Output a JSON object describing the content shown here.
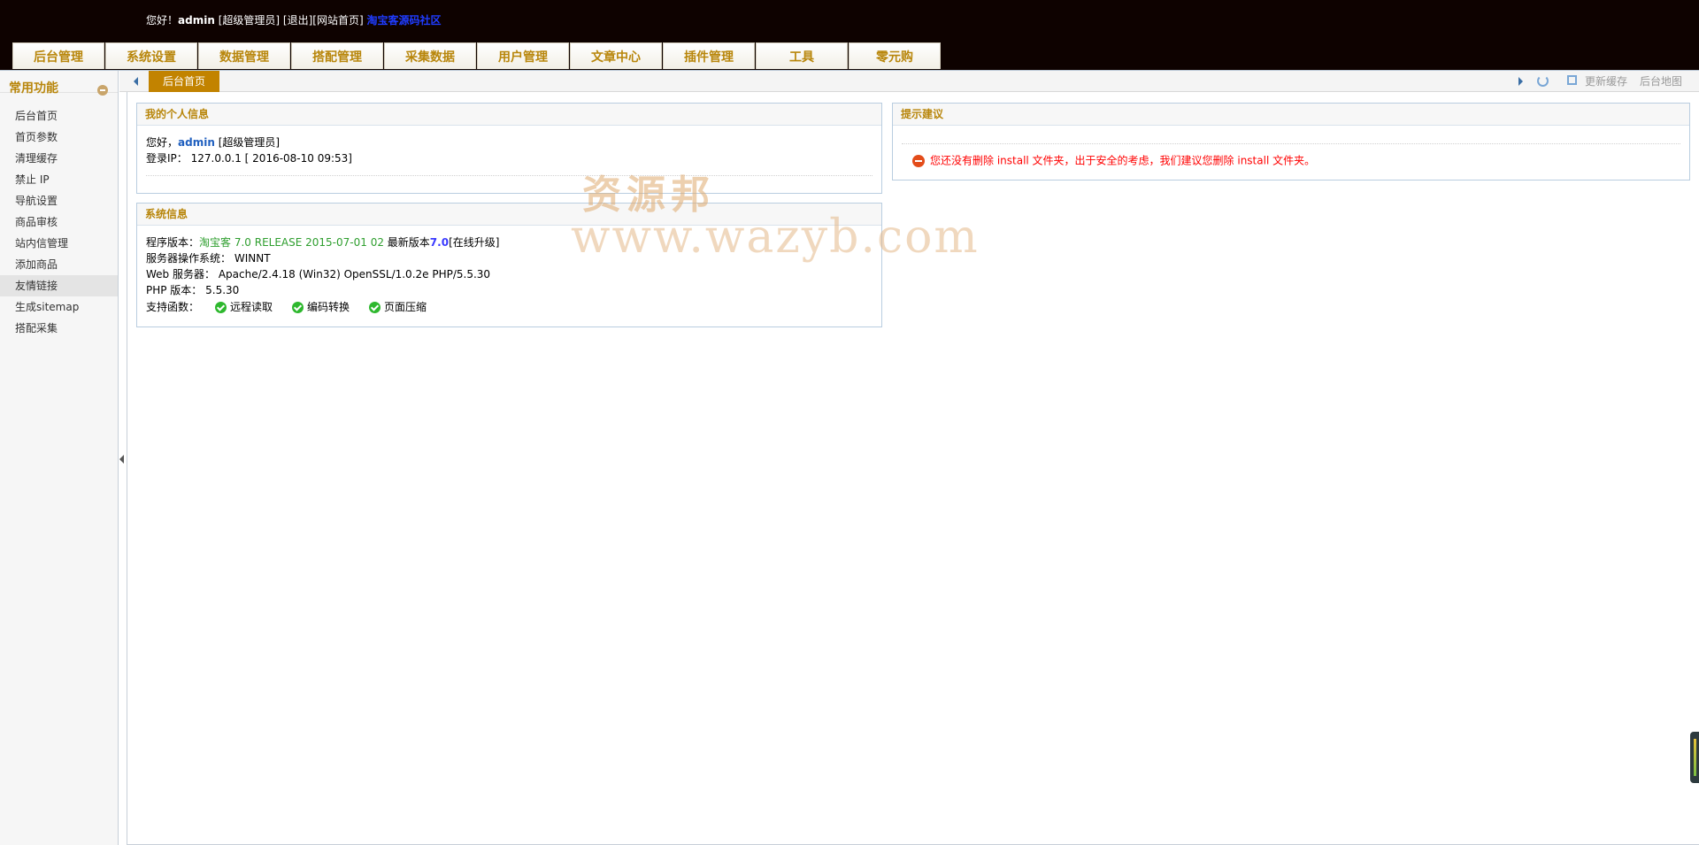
{
  "header": {
    "greeting": "您好！",
    "username": "admin",
    "role": "[超级管理员]",
    "logout": "[退出]",
    "site_home": "[网站首页]",
    "download_link": "淘宝客源码社区"
  },
  "nav": {
    "items": [
      "后台管理",
      "系统设置",
      "数据管理",
      "搭配管理",
      "采集数据",
      "用户管理",
      "文章中心",
      "插件管理",
      "工具",
      "零元购"
    ]
  },
  "sidebar": {
    "title": "常用功能",
    "items": [
      "后台首页",
      "首页参数",
      "清理缓存",
      "禁止 IP",
      "导航设置",
      "商品审核",
      "站内信管理",
      "添加商品",
      "友情链接",
      "生成sitemap",
      "搭配采集"
    ],
    "active_index": 8
  },
  "tabs": {
    "active": "后台首页",
    "update_cache": "更新缓存",
    "backend_map": "后台地图"
  },
  "personal": {
    "title": "我的个人信息",
    "hello": "您好，",
    "username": "admin",
    "role": "[超级管理员]",
    "login_ip_label": "登录IP：",
    "login_ip_value": "127.0.0.1 [ 2016-08-10 09:53]"
  },
  "system": {
    "title": "系统信息",
    "version_label": "程序版本：",
    "version_value": "淘宝客 7.0 RELEASE 2015-07-01 02",
    "latest_label": " 最新版本",
    "latest_value": "7.0",
    "upgrade_link": "[在线升级]",
    "os_label": "服务器操作系统：",
    "os_value": "WINNT",
    "web_label": "Web 服务器：",
    "web_value": "Apache/2.4.18 (Win32) OpenSSL/1.0.2e PHP/5.5.30",
    "php_label": "PHP 版本：",
    "php_value": "5.5.30",
    "funcs_label": "支持函数：",
    "funcs": [
      "远程读取",
      "编码转换",
      "页面压缩"
    ]
  },
  "tips": {
    "title": "提示建议",
    "warning": "您还没有删除 install 文件夹，出于安全的考虑，我们建议您删除 install 文件夹。"
  },
  "watermark": {
    "cn": "资源邦",
    "url": "www.wazyb.com"
  },
  "colors": {
    "header_bg": "#0e0200",
    "accent": "#b8860b",
    "active_tab": "#c28300",
    "warning": "#ff0000",
    "link_blue": "#1f5fbf"
  }
}
